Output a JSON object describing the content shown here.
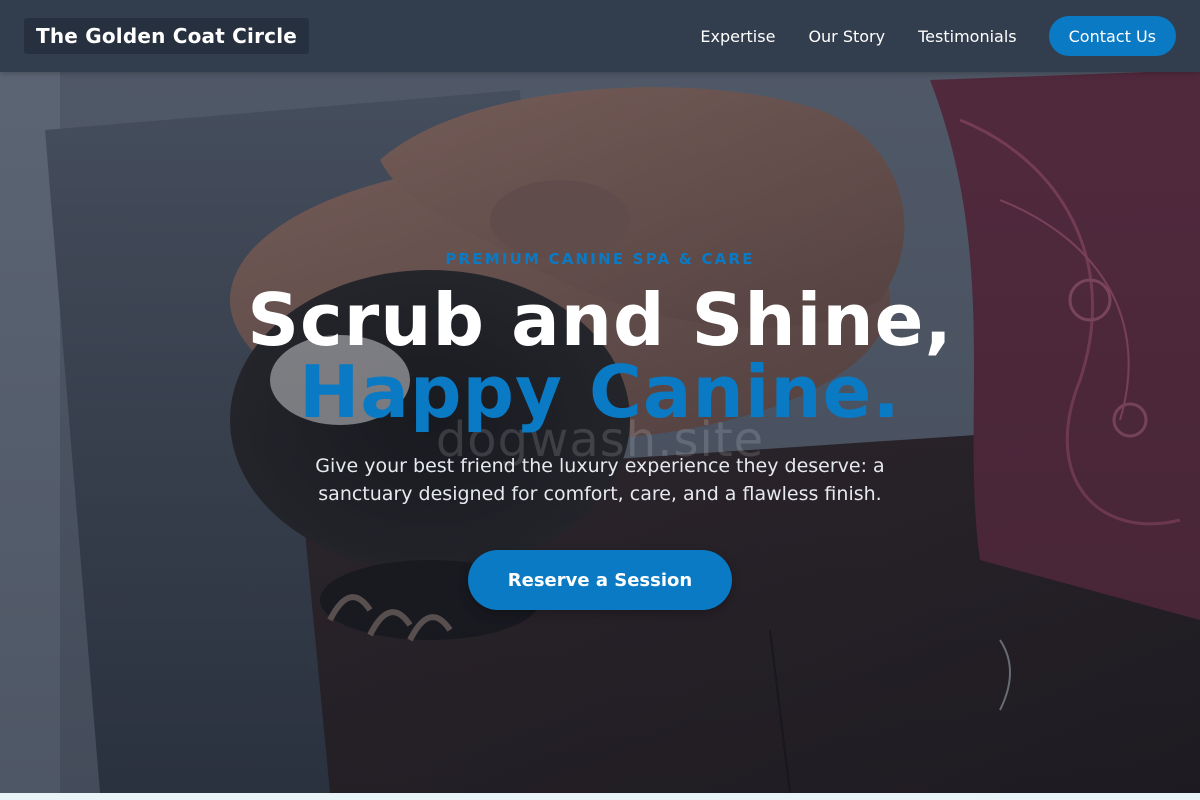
{
  "nav": {
    "brand": "The Golden Coat Circle",
    "links": [
      "Expertise",
      "Our Story",
      "Testimonials"
    ],
    "cta": "Contact Us"
  },
  "hero": {
    "eyebrow": "PREMIUM CANINE SPA & CARE",
    "title_line1": "Scrub and Shine,",
    "title_line2": "Happy Canine.",
    "watermark": "dogwash.site",
    "subtitle": "Give your best friend the luxury experience they deserve: a sanctuary designed for comfort, care, and a flawless finish.",
    "cta": "Reserve a Session"
  },
  "colors": {
    "accent": "#0a7ac4",
    "navbar": "#323d4e",
    "brand_bg": "#27303e",
    "page_bg": "#e8f4f8"
  }
}
